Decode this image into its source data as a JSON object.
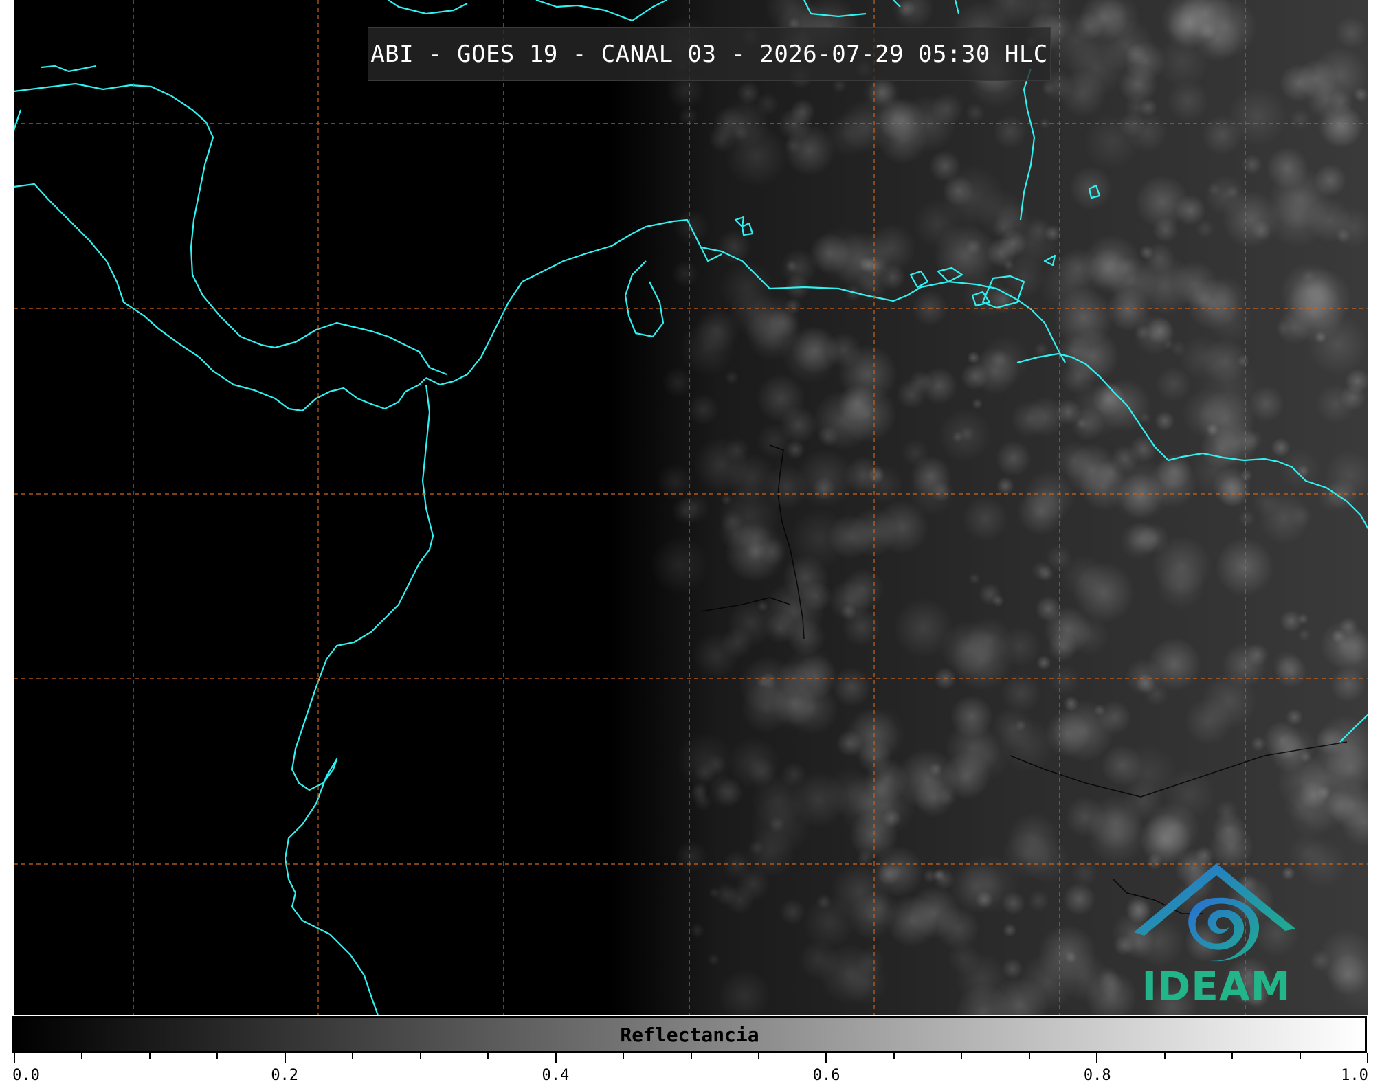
{
  "title": "ABI - GOES 19 - CANAL 03 - 2026-07-29 05:30 HLC",
  "logo": {
    "name": "IDEAM",
    "icon": "ideam-logo-icon",
    "colors": {
      "roof": "#2a7fd4",
      "spiral": "#1fae8c",
      "text": "#22b58a"
    }
  },
  "colorbar": {
    "label": "Reflectancia",
    "min": 0.0,
    "max": 1.0,
    "tick_labels": [
      "0.0",
      "0.2",
      "0.4",
      "0.6",
      "0.8",
      "1.0"
    ],
    "major_ticks": [
      0.0,
      0.2,
      0.4,
      0.6,
      0.8,
      1.0
    ],
    "minor_step": 0.05,
    "gradient": [
      "#000000",
      "#ffffff"
    ]
  },
  "map_style": {
    "coastline_color": "#30f0f0",
    "grid_color": "#c8641e",
    "border_color": "#000000"
  }
}
